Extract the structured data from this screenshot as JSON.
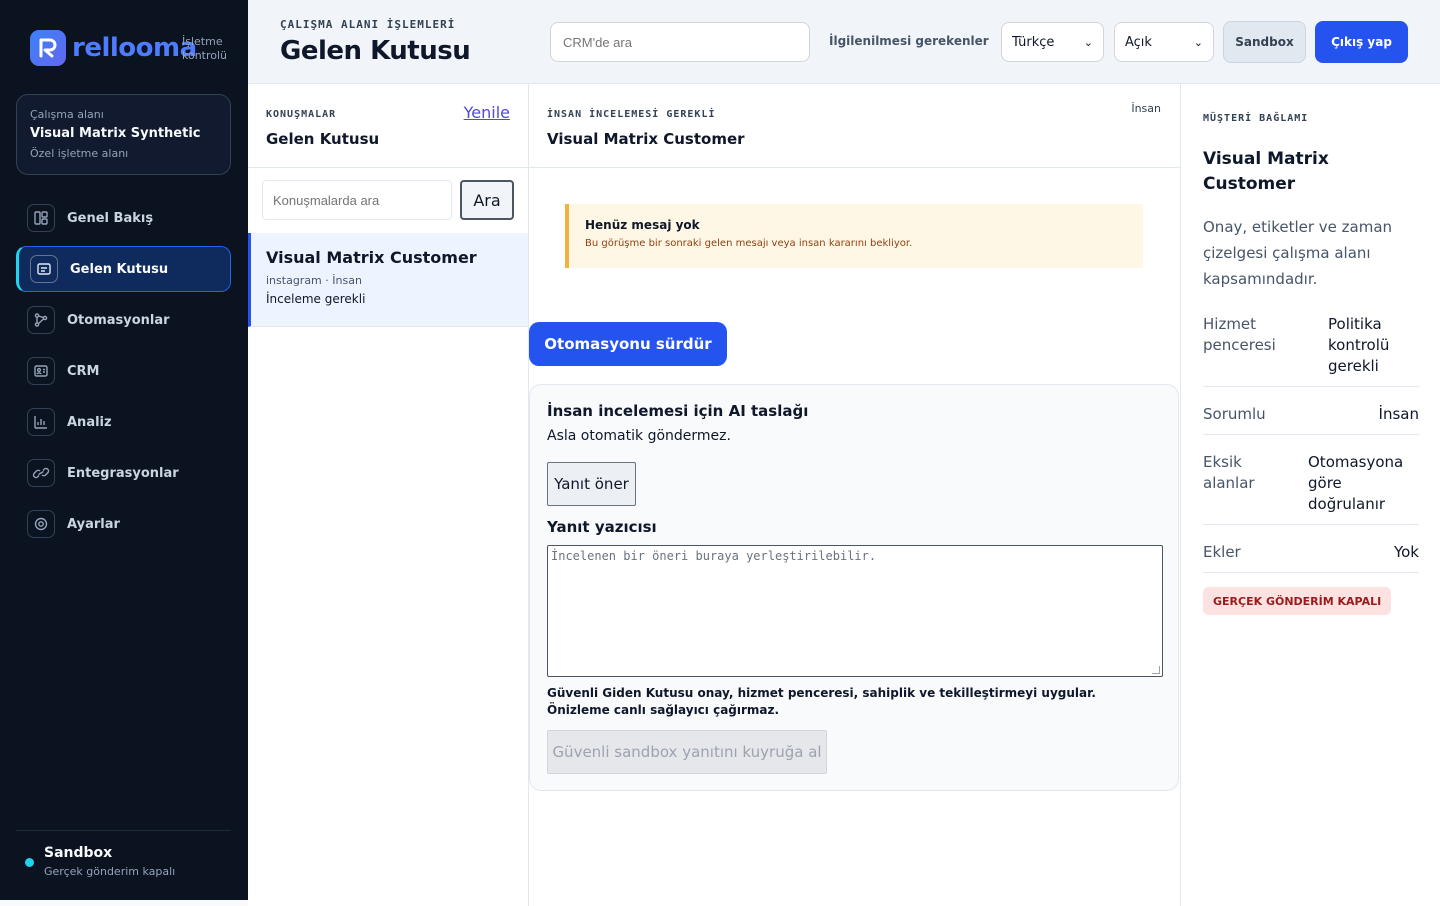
{
  "brand": {
    "name": "rellooma",
    "subtitle": "İşletme kontrolü"
  },
  "workspace": {
    "label": "Çalışma alanı",
    "name": "Visual Matrix Synthetic",
    "type": "Özel işletme alanı"
  },
  "nav": [
    {
      "label": "Genel Bakış",
      "icon": "grid-icon"
    },
    {
      "label": "Gelen Kutusu",
      "icon": "inbox-icon",
      "active": true
    },
    {
      "label": "Otomasyonlar",
      "icon": "workflow-icon"
    },
    {
      "label": "CRM",
      "icon": "contact-card-icon"
    },
    {
      "label": "Analiz",
      "icon": "bar-chart-icon"
    },
    {
      "label": "Entegrasyonlar",
      "icon": "link-icon"
    },
    {
      "label": "Ayarlar",
      "icon": "gear-icon"
    }
  ],
  "footer": {
    "title": "Sandbox",
    "subtitle": "Gerçek gönderim kapalı"
  },
  "header": {
    "eyebrow": "ÇALIŞMA ALANI İŞLEMLERİ",
    "title": "Gelen Kutusu",
    "search_placeholder": "CRM'de ara",
    "attention_link": "İlgilenilmesi gerekenler",
    "language": "Türkçe",
    "theme": "Açık",
    "sandbox_label": "Sandbox",
    "logout_label": "Çıkış yap"
  },
  "conversations": {
    "eyebrow": "KONUŞMALAR",
    "title": "Gelen Kutusu",
    "refresh": "Yenile",
    "search_placeholder": "Konuşmalarda ara",
    "search_button": "Ara",
    "items": [
      {
        "name": "Visual Matrix Customer",
        "meta": "instagram · İnsan",
        "status": "İnceleme gerekli"
      }
    ]
  },
  "thread": {
    "eyebrow": "İNSAN İNCELEMESİ GEREKLİ",
    "title": "Visual Matrix Customer",
    "tag": "İnsan",
    "notice": {
      "title": "Henüz mesaj yok",
      "text": "Bu görüşme bir sonraki gelen mesajı veya insan kararını bekliyor."
    },
    "resume_button": "Otomasyonu sürdür",
    "draft": {
      "title": "İnsan incelemesi için AI taslağı",
      "subtitle": "Asla otomatik göndermez.",
      "suggest_button": "Yanıt öner",
      "composer_label": "Yanıt yazıcısı",
      "composer_placeholder": "İncelenen bir öneri buraya yerleştirilebilir.",
      "guard_text": "Güvenli Giden Kutusu onay, hizmet penceresi, sahiplik ve tekilleştirmeyi uygular. Önizleme canlı sağlayıcı çağırmaz.",
      "queue_button": "Güvenli sandbox yanıtını kuyruğa al"
    }
  },
  "context": {
    "eyebrow": "MÜŞTERİ BAĞLAMI",
    "name": "Visual Matrix Customer",
    "description": "Onay, etiketler ve zaman çizelgesi çalışma alanı kapsamındadır.",
    "fields": [
      {
        "key": "Hizmet penceresi",
        "value": "Politika kontrolü gerekli"
      },
      {
        "key": "Sorumlu",
        "value": "İnsan"
      },
      {
        "key": "Eksik alanlar",
        "value": "Otomasyona göre doğrulanır"
      },
      {
        "key": "Ekler",
        "value": "Yok"
      }
    ],
    "badge": "GERÇEK GÖNDERİM KAPALI"
  },
  "colors": {
    "accent": "#2453f0",
    "sidebar": "#0b1220",
    "warning": "#f0b43c",
    "danger_bg": "#fde2e2"
  }
}
